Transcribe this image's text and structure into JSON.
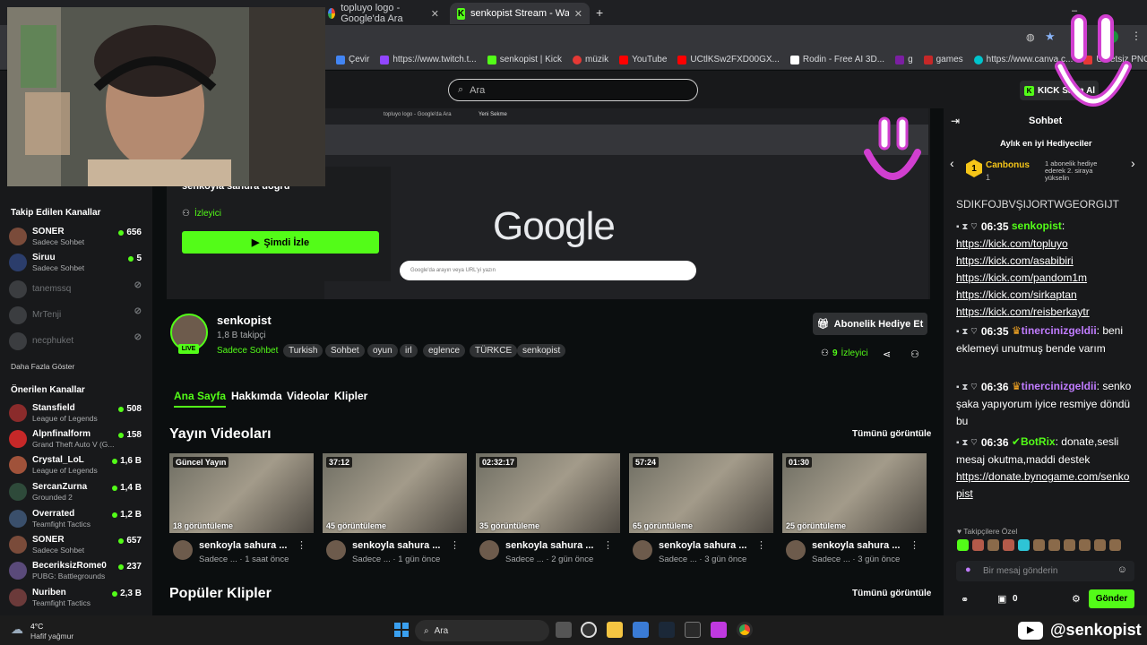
{
  "browser": {
    "tabs": [
      {
        "title": "topluyo logo - Google'da Ara",
        "favicon": "google-icon"
      },
      {
        "title": "senkopist Stream - Watch Live o",
        "favicon": "kick-icon"
      }
    ],
    "new_tab": "+",
    "bookmarks": [
      {
        "label": "Çevir",
        "color": "#4285f4"
      },
      {
        "label": "https://www.twitch.t...",
        "color": "#9146ff"
      },
      {
        "label": "senkopist | Kick",
        "color": "#53fc18"
      },
      {
        "label": "müzik",
        "color": "#e53935"
      },
      {
        "label": "YouTube",
        "color": "#ff0000"
      },
      {
        "label": "UCtlKSw2FXD00GX...",
        "color": "#ff0000"
      },
      {
        "label": "Rodin - Free AI 3D...",
        "color": "#ffffff"
      },
      {
        "label": "g",
        "color": "#7b1fa2"
      },
      {
        "label": "games",
        "color": "#c62828"
      },
      {
        "label": "https://www.canva.c...",
        "color": "#00c4cc"
      },
      {
        "label": "Ücretsiz PNG Olustu...",
        "color": "#e53935"
      }
    ]
  },
  "header": {
    "search_placeholder": "Ara",
    "kick_button": "KICK Satın Al"
  },
  "sidebar": {
    "followed_title": "Takip Edilen Kanallar",
    "followed": [
      {
        "name": "SONER",
        "category": "Sadece Sohbet",
        "viewers": "656",
        "live": true
      },
      {
        "name": "Siruu",
        "category": "Sadece Sohbet",
        "viewers": "5",
        "live": true
      },
      {
        "name": "tanemssq",
        "category": "",
        "viewers": "",
        "live": false
      },
      {
        "name": "MrTenji",
        "category": "",
        "viewers": "",
        "live": false
      },
      {
        "name": "necphuket",
        "category": "",
        "viewers": "",
        "live": false
      }
    ],
    "show_more": "Daha Fazla Göster",
    "recommended_title": "Önerilen Kanallar",
    "recommended": [
      {
        "name": "Stansfield",
        "category": "League of Legends",
        "viewers": "508"
      },
      {
        "name": "Alpnfinalform",
        "category": "Grand Theft Auto V (G...",
        "viewers": "158"
      },
      {
        "name": "Crystal_LoL",
        "category": "League of Legends",
        "viewers": "1,6 B"
      },
      {
        "name": "SercanZurna",
        "category": "Grounded 2",
        "viewers": "1,4 B"
      },
      {
        "name": "Overrated",
        "category": "Teamfight Tactics",
        "viewers": "1,2 B"
      },
      {
        "name": "SONER",
        "category": "Sadece Sohbet",
        "viewers": "657"
      },
      {
        "name": "BeceriksizRome0",
        "category": "PUBG: Battlegrounds",
        "viewers": "237"
      },
      {
        "name": "Nuriben",
        "category": "Teamfight Tactics",
        "viewers": "2,3 B"
      }
    ]
  },
  "player": {
    "offline_title": "senkoyla sahura doğru",
    "viewer_label": "İzleyici",
    "watch_now": "Şimdi İzle",
    "inner_tabs": [
      "topluyo logo - Google'da Ara",
      "Yeni Sekme"
    ],
    "google_logo": "Google",
    "google_search_placeholder": "Google'da arayın veya URL'yi yazın"
  },
  "channel": {
    "name": "senkopist",
    "followers": "1,8 B takipçi",
    "category": "Sadece Sohbet",
    "live_badge": "LIVE",
    "tags": [
      "Turkish",
      "Sohbet",
      "oyun",
      "irl",
      "eglence",
      "TÜRKCE",
      "senkopist"
    ],
    "sub_gift": "Abonelik Hediye Et",
    "viewers": "9",
    "viewers_label": "İzleyici"
  },
  "tabs": [
    "Ana Sayfa",
    "Hakkımda",
    "Videolar",
    "Klipler"
  ],
  "videos_section": {
    "title": "Yayın Videoları",
    "see_all": "Tümünü görüntüle"
  },
  "videos": [
    {
      "duration": "Güncel Yayın",
      "views": "18 görüntüleme",
      "title": "senkoyla sahura ...",
      "sub": "Sadece ...",
      "age": "1 saat önce"
    },
    {
      "duration": "37:12",
      "views": "45 görüntüleme",
      "title": "senkoyla sahura ...",
      "sub": "Sadece ...",
      "age": "1 gün önce"
    },
    {
      "duration": "02:32:17",
      "views": "35 görüntüleme",
      "title": "senkoyla sahura ...",
      "sub": "Sadece ...",
      "age": "2 gün önce"
    },
    {
      "duration": "57:24",
      "views": "65 görüntüleme",
      "title": "senkoyla sahura ...",
      "sub": "Sadece ...",
      "age": "3 gün önce"
    },
    {
      "duration": "01:30",
      "views": "25 görüntüleme",
      "title": "senkoyla sahura ...",
      "sub": "Sadece ...",
      "age": "3 gün önce"
    }
  ],
  "clips_section": {
    "title": "Popüler Klipler",
    "see_all": "Tümünü görüntüle"
  },
  "chat": {
    "title": "Sohbet",
    "top_gifters_title": "Aylık en iyi Hediyeciler",
    "top_gifter_name": "Canbonus",
    "top_gifter_count": "1",
    "top_gifter_rank": "1",
    "gift_note": "1 abonelik hediye ederek 2. siraya yükselin",
    "partial_line": "SDIKFOJBVŞIJORTWGEORGIJT",
    "messages": [
      {
        "time": "06:35",
        "user": "senkopist",
        "color": "#53fc18",
        "links": [
          "https://kick.com/topluyo",
          "https://kick.com/asabibiri",
          "https://kick.com/pandom1m",
          "https://kick.com/sirkaptan",
          "https://kick.com/reisberkaytr"
        ]
      },
      {
        "time": "06:35",
        "user": "tinercinizgeldii",
        "color": "#c07cff",
        "text": "beni eklemeyi unutmuş bende varım"
      },
      {
        "time": "06:36",
        "user": "tinercinizgeldii",
        "color": "#c07cff",
        "text": "senko şaka yapıyorum iyice resmiye döndü bu"
      },
      {
        "time": "06:36",
        "user": "BotRix",
        "color": "#53fc18",
        "text": "donate,sesli mesaj okutma,maddi destek",
        "link": "https://donate.bynogame.com/senkopist"
      }
    ],
    "follower_emotes_label": "Takipçilere Özel",
    "input_placeholder": "Bir mesaj gönderin",
    "points": "0",
    "send": "Gönder"
  },
  "taskbar": {
    "weather_temp": "4°C",
    "weather_desc": "Hafif yağmur",
    "search_placeholder": "Ara"
  },
  "watermark": {
    "handle": "@senkopist"
  }
}
